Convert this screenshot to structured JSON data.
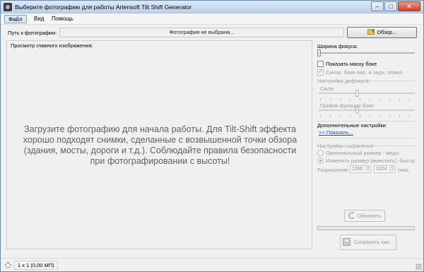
{
  "window": {
    "title": "Выберите фотографию для работы Artensoft Tilt Shift Generator",
    "controls": {
      "minimize": "–",
      "maximize": "□",
      "close": "✕"
    }
  },
  "menu": {
    "items": [
      {
        "label": "Файл"
      },
      {
        "label": "Вид"
      },
      {
        "label": "Помощь"
      }
    ]
  },
  "path": {
    "label": "Путь к фотографии:",
    "value": "Фотография не выбрана...",
    "browse_label": "Обзор..."
  },
  "preview": {
    "label": "Просмотр главного изображения:",
    "message": "Загрузите фотографию для начала работы. Для Tilt-Shift эффекта хорошо подходят снимки, сделанные с возвышенной точки обзора (здания, мосты, дороги и т.д.). Соблюдайте правила безопасности при фотографировании с высоты!"
  },
  "side": {
    "focus_width_label": "Ширина фокуса:",
    "focus_width_value": 0,
    "show_bokeh_mask_label": "Показать маску боке",
    "show_bokeh_mask_checked": false,
    "sync_bokeh_label": "Синхр. боке пер. и задн. плана",
    "sync_bokeh_checked": true,
    "defocus_settings_label": "Настройки дефокуса:",
    "strength_label": "Сила:",
    "strength_value": 0.4,
    "bokeh_graph_label": "График функции боке:",
    "bokeh_graph_value": 0.4,
    "additional_settings_label": "Дополнительные настройки",
    "show_link": ">> Показать...",
    "save_settings_label": "Настройки сохранения",
    "original_size_label": "Оригинальный размер - медл.",
    "resize_label": "Изменить размер (вместить) -быстр.",
    "resolution_label": "Разрешение:",
    "width_value": "1280",
    "height_value": "1024",
    "unit_label": "пикс.",
    "refresh_label": "Обновить",
    "save_as_label": "Сохранить как..."
  },
  "status": {
    "text": "1 x 1 (0,00 МП)"
  }
}
